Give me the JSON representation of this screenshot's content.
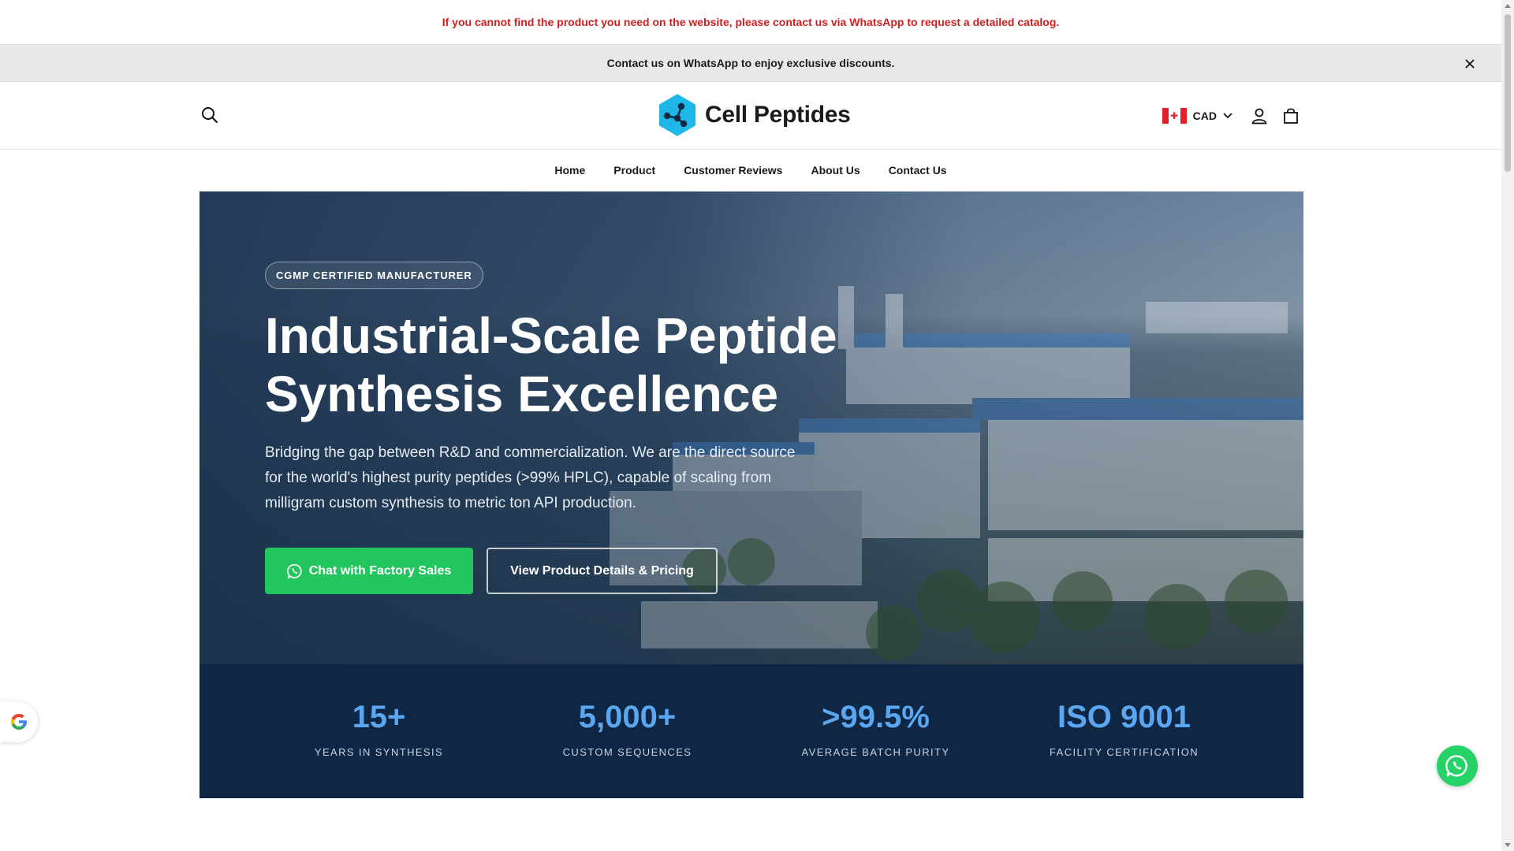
{
  "top_notice": "If you cannot find the product you need on the website, please contact us via WhatsApp to request a detailed catalog.",
  "announcement": "Contact us on WhatsApp to enjoy exclusive discounts.",
  "header": {
    "logo_text": "Cell Peptides",
    "currency": "CAD"
  },
  "nav": [
    "Home",
    "Product",
    "Customer Reviews",
    "About Us",
    "Contact Us"
  ],
  "hero": {
    "badge": "CGMP CERTIFIED MANUFACTURER",
    "title": "Industrial-Scale Peptide Synthesis Excellence",
    "description": "Bridging the gap between R&D and commercialization. We are the direct source for the world's highest purity peptides (>99% HPLC), capable of scaling from milligram custom synthesis to metric ton API production.",
    "primary_button": "Chat with Factory Sales",
    "secondary_button": "View Product Details & Pricing"
  },
  "stats": [
    {
      "value": "15+",
      "label": "YEARS IN SYNTHESIS"
    },
    {
      "value": "5,000+",
      "label": "CUSTOM SEQUENCES"
    },
    {
      "value": ">99.5%",
      "label": "AVERAGE BATCH PURITY"
    },
    {
      "value": "ISO 9001",
      "label": "FACILITY CERTIFICATION"
    }
  ],
  "colors": {
    "notice_red": "#d11f1f",
    "whatsapp_green": "#22c55e",
    "stats_bg": "#0f2744",
    "stats_value_blue": "#5aa6f0",
    "logo_cyan": "#1fb6e8"
  },
  "icons": [
    "search-icon",
    "close-icon",
    "canada-flag-icon",
    "chevron-down-icon",
    "user-icon",
    "bag-icon",
    "whatsapp-icon",
    "google-icon"
  ]
}
